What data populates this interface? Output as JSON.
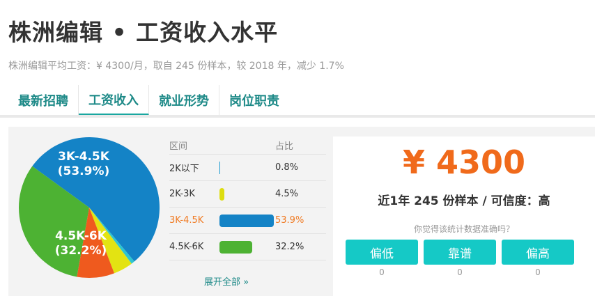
{
  "header": {
    "title": "株洲编辑 • 工资收入水平",
    "subtitle": "株洲编辑平均工资：¥ 4300/月，取自 245 份样本，较 2018 年，减少 1.7%"
  },
  "tabs": [
    {
      "label": "最新招聘",
      "active": false
    },
    {
      "label": "工资收入",
      "active": true
    },
    {
      "label": "就业形势",
      "active": false
    },
    {
      "label": "岗位职责",
      "active": false
    }
  ],
  "distribution": {
    "head_range": "区间",
    "head_pct": "占比",
    "rows": [
      {
        "range": "2K以下",
        "pct": "0.8%",
        "value": 0.8,
        "color": "#1a9ad1",
        "highlight": false
      },
      {
        "range": "2K-3K",
        "pct": "4.5%",
        "value": 4.5,
        "color": "#dddd10",
        "highlight": false
      },
      {
        "range": "3K-4.5K",
        "pct": "53.9%",
        "value": 53.9,
        "color": "#1483c6",
        "highlight": true
      },
      {
        "range": "4.5K-6K",
        "pct": "32.2%",
        "value": 32.2,
        "color": "#4db233",
        "highlight": false
      }
    ],
    "expand_label": "展开全部 »"
  },
  "chart_data": {
    "type": "pie",
    "slices": [
      {
        "label": "3K-4.5K",
        "value": 53.9,
        "color": "#1483c6",
        "display": [
          "3K-4.5K",
          "(53.9%)"
        ]
      },
      {
        "label": "other",
        "value": 0.8,
        "color": "#2ec5d0",
        "display": []
      },
      {
        "label": "2K-3K",
        "value": 4.5,
        "color": "#e3e312",
        "display": []
      },
      {
        "label": "other-orange",
        "value": 8.6,
        "color": "#ef5a1e",
        "display": []
      },
      {
        "label": "4.5K-6K",
        "value": 32.2,
        "color": "#4db233",
        "display": [
          "4.5K-6K",
          "(32.2%)"
        ]
      }
    ]
  },
  "summary": {
    "salary": "¥ 4300",
    "sample_text": "近1年 245 份样本 / 可信度：高",
    "question": "你觉得该统计数据准确吗？"
  },
  "votes": [
    {
      "label": "偏低",
      "count": "0"
    },
    {
      "label": "靠谱",
      "count": "0"
    },
    {
      "label": "偏高",
      "count": "0"
    }
  ]
}
